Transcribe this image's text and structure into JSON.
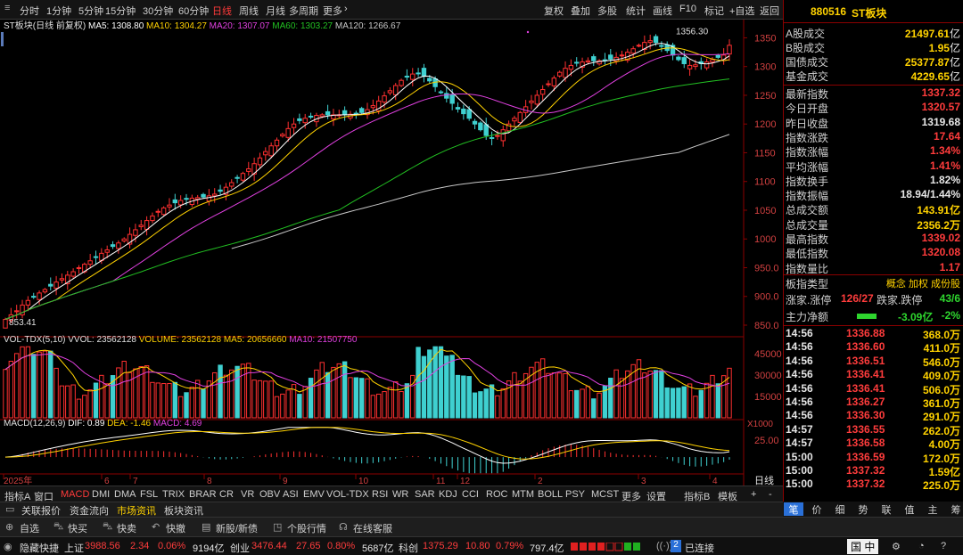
{
  "topbar": {
    "periods": [
      "分时",
      "1分钟",
      "5分钟",
      "15分钟",
      "30分钟",
      "60分钟",
      "日线",
      "周线",
      "月线",
      "多周期",
      "更多"
    ],
    "active_period": "日线",
    "actions": [
      "复权",
      "叠加",
      "多股",
      "统计",
      "画线",
      "F10",
      "标记",
      "+自选",
      "返回"
    ]
  },
  "chart_data": [
    {
      "type": "candlestick",
      "title": "ST板块(日线 前复权)",
      "legend": [
        {
          "name": "MA5",
          "value": "1308.80",
          "color": "#ffffff"
        },
        {
          "name": "MA10",
          "value": "1304.27",
          "color": "#ffd200"
        },
        {
          "name": "MA20",
          "value": "1307.07",
          "color": "#e040e0"
        },
        {
          "name": "MA60",
          "value": "1303.27",
          "color": "#22c022"
        },
        {
          "name": "MA120",
          "value": "1266.67",
          "color": "#c8c8c8"
        }
      ],
      "ylim": [
        850,
        1360
      ],
      "y_ticks": [
        850,
        900,
        950,
        1000,
        1050,
        1100,
        1150,
        1200,
        1250,
        1300,
        1350
      ],
      "y_tick_labels": [
        "850.0",
        "900.0",
        "950.0",
        "1000",
        "1050",
        "1100",
        "1150",
        "1200",
        "1250",
        "1300",
        "1350"
      ],
      "high_label": "1356.30",
      "low_label": "853.41",
      "x_labels": [
        "2025年",
        "6",
        "7",
        "8",
        "9",
        "10",
        "11",
        "12",
        "2",
        "3",
        "4"
      ],
      "period_label": "日线",
      "closes": [
        860,
        868,
        875,
        885,
        893,
        900,
        906,
        912,
        918,
        925,
        931,
        937,
        943,
        950,
        956,
        962,
        968,
        975,
        981,
        987,
        993,
        1000,
        1008,
        1016,
        1024,
        1032,
        1040,
        1048,
        1054,
        1059,
        1063,
        1067,
        1069,
        1071,
        1072,
        1073,
        1075,
        1078,
        1083,
        1090,
        1098,
        1106,
        1114,
        1122,
        1131,
        1141,
        1152,
        1162,
        1172,
        1182,
        1192,
        1200,
        1206,
        1210,
        1213,
        1215,
        1216,
        1216,
        1216,
        1216,
        1216,
        1217,
        1218,
        1220,
        1225,
        1232,
        1240,
        1249,
        1258,
        1267,
        1276,
        1283,
        1287,
        1288,
        1283,
        1275,
        1265,
        1255,
        1245,
        1236,
        1226,
        1218,
        1210,
        1200,
        1190,
        1180,
        1175,
        1180,
        1190,
        1200,
        1210,
        1220,
        1230,
        1240,
        1250,
        1260,
        1270,
        1280,
        1290,
        1297,
        1302,
        1306,
        1308,
        1310,
        1310,
        1310,
        1311,
        1313,
        1316,
        1320,
        1325,
        1331,
        1337,
        1342,
        1345,
        1342,
        1336,
        1328,
        1320,
        1312,
        1305,
        1302,
        1303,
        1305,
        1308,
        1312,
        1316,
        1320,
        1337
      ]
    },
    {
      "type": "bar",
      "title": "VOL-TDX(5,10)",
      "legend": [
        {
          "name": "VVOL",
          "value": "23562128",
          "color": "#e0e0e0"
        },
        {
          "name": "VOLUME",
          "value": "23562128",
          "color": "#ffd200"
        },
        {
          "name": "MA5",
          "value": "20656660",
          "color": "#ffd200"
        },
        {
          "name": "MA10",
          "value": "21507750",
          "color": "#e040e0"
        }
      ],
      "y_tick_labels": [
        "45000",
        "30000",
        "15000"
      ],
      "y_ticks": [
        45000,
        30000,
        15000
      ],
      "unit_label": "X1000",
      "ylim": [
        0,
        52000
      ]
    },
    {
      "type": "line",
      "title": "MACD(12,26,9)",
      "legend": [
        {
          "name": "DIF",
          "value": "0.89",
          "color": "#ffffff"
        },
        {
          "name": "DEA",
          "value": "-1.46",
          "color": "#ffd200"
        },
        {
          "name": "MACD",
          "value": "4.69",
          "color": "#e040e0"
        }
      ],
      "y_tick_labels": [
        "25.00"
      ],
      "y_ticks": [
        25
      ],
      "ylim": [
        -25,
        45
      ]
    }
  ],
  "right_panel": {
    "code": "880516",
    "name": "ST板块",
    "turnover": [
      {
        "label": "A股成交",
        "value": "21497.61",
        "unit": "亿"
      },
      {
        "label": "B股成交",
        "value": "1.95",
        "unit": "亿"
      },
      {
        "label": "国债成交",
        "value": "25377.87",
        "unit": "亿"
      },
      {
        "label": "基金成交",
        "value": "4229.65",
        "unit": "亿"
      }
    ],
    "stats": [
      {
        "label": "最新指数",
        "value": "1337.32",
        "color": "#ff3c3c"
      },
      {
        "label": "今日开盘",
        "value": "1320.57",
        "color": "#ff3c3c"
      },
      {
        "label": "昨日收盘",
        "value": "1319.68",
        "color": "#e6e6e6"
      },
      {
        "label": "指数涨跌",
        "value": "17.64",
        "color": "#ff3c3c"
      },
      {
        "label": "指数涨幅",
        "value": "1.34%",
        "color": "#ff3c3c"
      },
      {
        "label": "平均涨幅",
        "value": "1.41%",
        "color": "#ff3c3c"
      },
      {
        "label": "指数换手",
        "value": "1.82%",
        "color": "#e6e6e6"
      },
      {
        "label": "指数振幅",
        "value": "18.94/1.44%",
        "color": "#e6e6e6"
      },
      {
        "label": "总成交额",
        "value": "143.91亿",
        "color": "#ffd200"
      },
      {
        "label": "总成交量",
        "value": "2356.2万",
        "color": "#ffd200"
      },
      {
        "label": "最高指数",
        "value": "1339.02",
        "color": "#ff3c3c"
      },
      {
        "label": "最低指数",
        "value": "1320.08",
        "color": "#ff3c3c"
      },
      {
        "label": "指数量比",
        "value": "1.17",
        "color": "#ff3c3c"
      }
    ],
    "type_label": "板指类型",
    "type_value": "概念 加权 成份股",
    "updown_label": "涨家.涨停",
    "updown_value": "126/27",
    "down_label": "跌家.跌停",
    "down_value": "43/6",
    "flow_label": "主力净额",
    "flow_value": "-3.09亿",
    "flow_pct": "-2%",
    "ticks": [
      {
        "time": "14:56",
        "price": "1336.88",
        "vol": "368.0万"
      },
      {
        "time": "14:56",
        "price": "1336.60",
        "vol": "411.0万"
      },
      {
        "time": "14:56",
        "price": "1336.51",
        "vol": "546.0万"
      },
      {
        "time": "14:56",
        "price": "1336.41",
        "vol": "409.0万"
      },
      {
        "time": "14:56",
        "price": "1336.41",
        "vol": "506.0万"
      },
      {
        "time": "14:56",
        "price": "1336.27",
        "vol": "361.0万"
      },
      {
        "time": "14:56",
        "price": "1336.30",
        "vol": "291.0万"
      },
      {
        "time": "14:57",
        "price": "1336.55",
        "vol": "262.0万"
      },
      {
        "time": "14:57",
        "price": "1336.58",
        "vol": "4.00万"
      },
      {
        "time": "15:00",
        "price": "1336.59",
        "vol": "172.0万"
      },
      {
        "time": "15:00",
        "price": "1337.32",
        "vol": "1.59亿"
      },
      {
        "time": "15:00",
        "price": "1337.32",
        "vol": "225.0万"
      }
    ]
  },
  "indicator_bar": [
    "指标A",
    "窗口",
    "MACD",
    "DMI",
    "DMA",
    "FSL",
    "TRIX",
    "BRAR",
    "CR",
    "VR",
    "OBV",
    "ASI",
    "EMV",
    "VOL-TDX",
    "RSI",
    "WR",
    "SAR",
    "KDJ",
    "CCI",
    "ROC",
    "MTM",
    "BOLL",
    "PSY",
    "MCST",
    "更多",
    "设置"
  ],
  "indicator_active": "MACD",
  "indicator_right": [
    "指标B",
    "模板",
    "+",
    "-"
  ],
  "info_tabs": [
    "关联报价",
    "资金流向",
    "市场资讯",
    "板块资讯"
  ],
  "right_tabs": [
    "笔",
    "价",
    "细",
    "势",
    "联",
    "值",
    "主",
    "筹"
  ],
  "toolbar": [
    "自选",
    "快买",
    "快卖",
    "快撤",
    "新股/新债",
    "个股行情",
    "在线客服"
  ],
  "status": {
    "hide": "隐藏快捷",
    "sh_name": "上证",
    "sh_val": "3988.56",
    "sh_chg": "2.34",
    "sh_pct": "0.06%",
    "sh_amt": "9194亿",
    "cy_name": "创业",
    "cy_val": "3476.44",
    "cy_chg": "27.65",
    "cy_pct": "0.80%",
    "cy_amt": "5687亿",
    "kc_name": "科创",
    "kc_val": "1375.29",
    "kc_chg": "10.80",
    "kc_pct": "0.79%",
    "kc_amt": "797.4亿",
    "conn_count": "2",
    "conn_label": "已连接",
    "ime": "国 中"
  }
}
